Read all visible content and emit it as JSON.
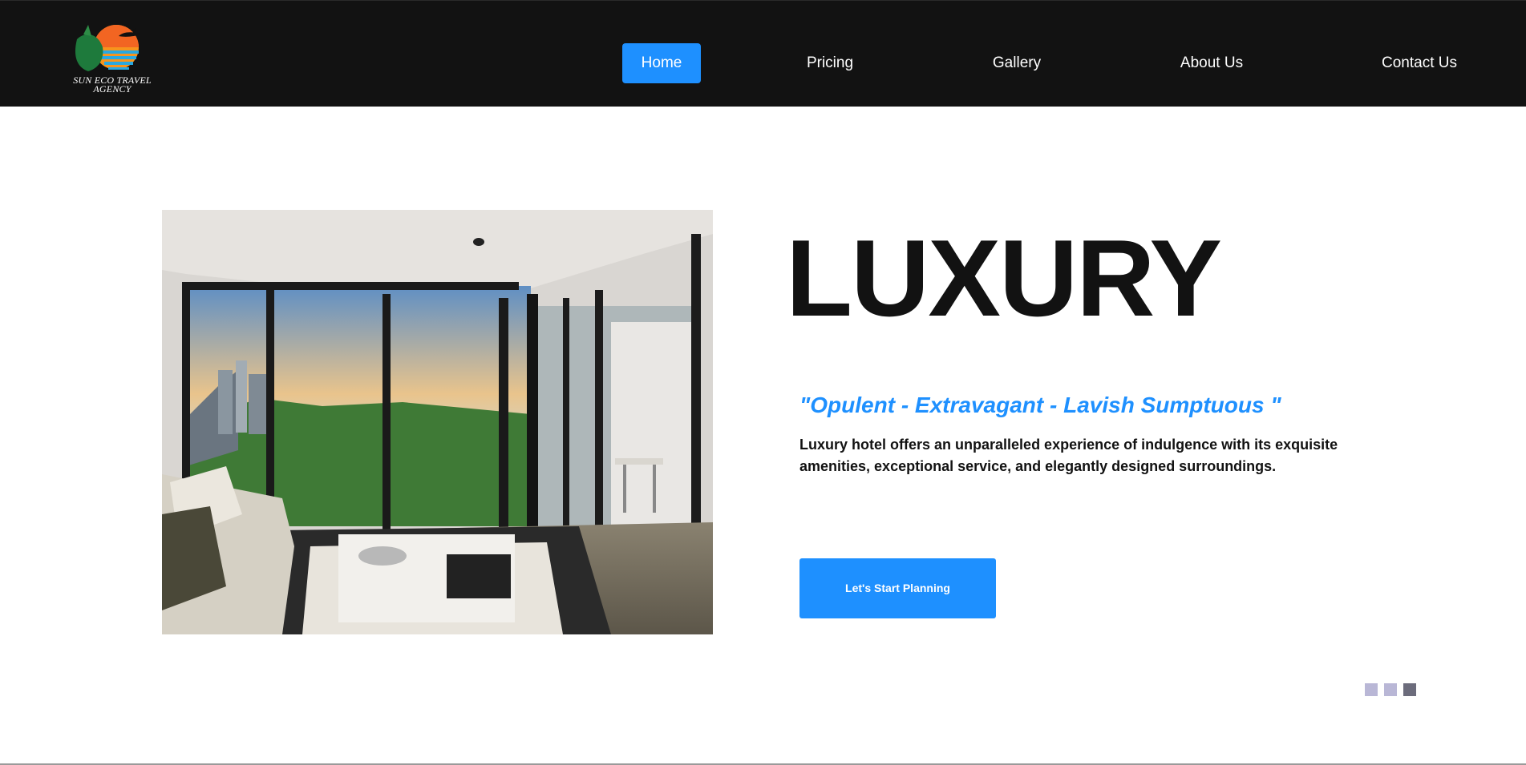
{
  "header": {
    "logo": {
      "text_line1": "SUN ECO TRAVEL",
      "text_line2": "AGENCY",
      "icon": "sun-eco-logo-icon"
    },
    "nav": [
      {
        "label": "Home",
        "active": true
      },
      {
        "label": "Pricing",
        "active": false
      },
      {
        "label": "Gallery",
        "active": false
      },
      {
        "label": "About Us",
        "active": false
      },
      {
        "label": "Contact Us",
        "active": false
      }
    ]
  },
  "hero": {
    "photo": "luxury-apartment-interior-photo",
    "title": "LUXURY",
    "tagline": "\"Opulent - Extravagant - Lavish Sumptuous \"",
    "description": "Luxury hotel offers an unparalleled experience of indulgence with its exquisite amenities, exceptional service, and elegantly designed surroundings.",
    "cta_label": "Let's Start Planning"
  },
  "slider": {
    "count": 3,
    "active_index": 2
  },
  "colors": {
    "header_bg": "#121212",
    "accent": "#1e90ff",
    "text": "#121212",
    "dot_inactive": "#b9b7d6",
    "dot_active": "#6c6c7c"
  }
}
